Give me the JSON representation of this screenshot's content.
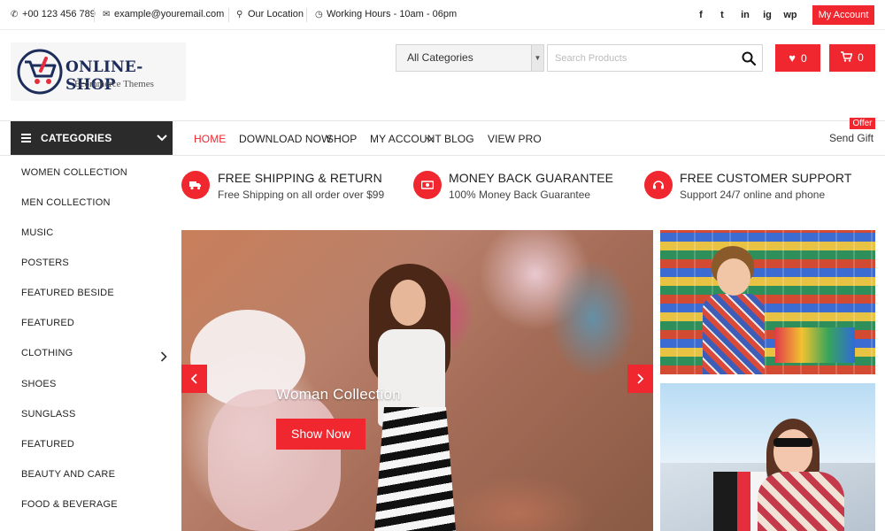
{
  "topbar": {
    "phone": "+00 123 456 789",
    "email": "example@youremail.com",
    "location": "Our Location",
    "hours": "Working Hours - 10am - 06pm",
    "social": [
      "f",
      "t",
      "in",
      "ig",
      "wp"
    ],
    "account_label": "My Account"
  },
  "header": {
    "logo_title": "ONLINE-SHOP",
    "logo_subtitle": "Ecommerce Themes",
    "category_select": "All Categories",
    "search_placeholder": "Search Products",
    "wishlist_count": "0",
    "cart_count": "0"
  },
  "nav": {
    "categories_label": "CATEGORIES",
    "links": [
      "HOME",
      "DOWNLOAD NOW",
      "SHOP",
      "MY ACCOUNT",
      "BLOG",
      "VIEW PRO"
    ],
    "offer_badge": "Offer",
    "send_gift": "Send Gift"
  },
  "sidebar": {
    "items": [
      "WOMEN COLLECTION",
      "MEN COLLECTION",
      "MUSIC",
      "POSTERS",
      "FEATURED BESIDE",
      "FEATURED",
      "CLOTHING",
      "SHOES",
      "SUNGLASS",
      "FEATURED",
      "BEAUTY AND CARE",
      "FOOD & BEVERAGE"
    ]
  },
  "features": [
    {
      "title": "FREE SHIPPING & RETURN",
      "subtitle": "Free Shipping on all order over $99",
      "icon": "truck-icon"
    },
    {
      "title": "MONEY BACK GUARANTEE",
      "subtitle": "100% Money Back Guarantee",
      "icon": "money-icon"
    },
    {
      "title": "FREE CUSTOMER SUPPORT",
      "subtitle": "Support 24/7 online and phone",
      "icon": "headset-icon"
    }
  ],
  "banner": {
    "title": "Woman Collection",
    "button_label": "Show Now"
  },
  "colors": {
    "accent": "#f0272f",
    "dark": "#2b2b2b",
    "logo_blue": "#1c2c5b"
  }
}
